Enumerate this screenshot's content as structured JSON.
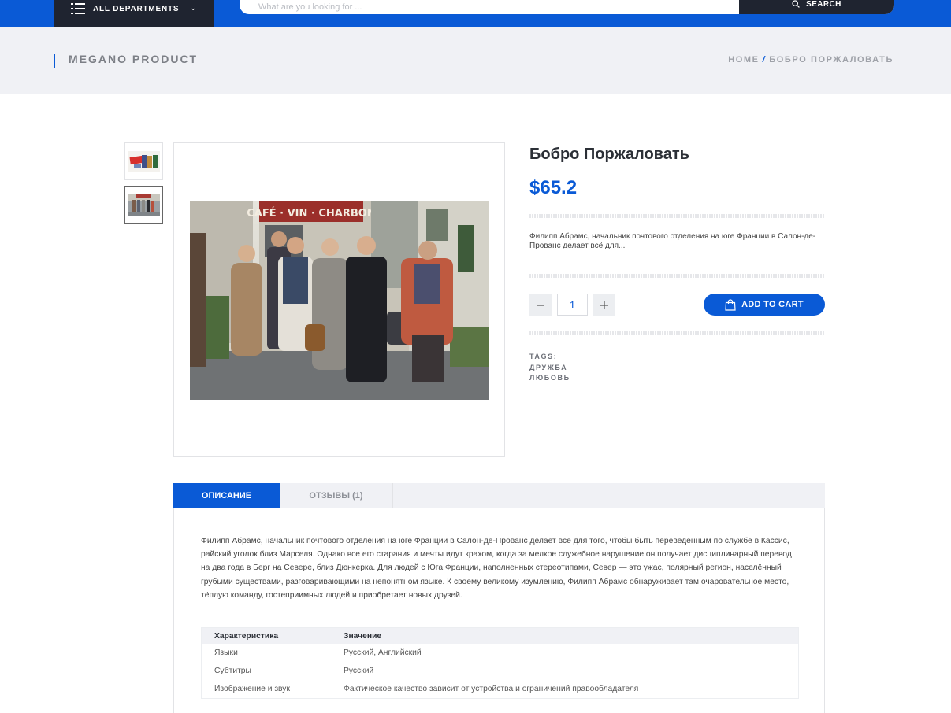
{
  "header": {
    "departments_label": "ALL DEPARTMENTS",
    "search_placeholder": "What are you looking for ...",
    "search_button": "SEARCH"
  },
  "titlebar": {
    "title": "MEGANO PRODUCT",
    "breadcrumb": {
      "home": "HOME",
      "separator": "/",
      "current": "БОБРО ПОРЖАЛОВАТЬ"
    }
  },
  "product": {
    "title": "Бобро Поржаловать",
    "price": "$65.2",
    "short_description": "Филипп Абрамс, начальник почтового отделения на юге Франции в Салон-де-Прованс делает всё для...",
    "quantity": "1",
    "add_to_cart": "ADD TO CART",
    "tags_label": "TAGS:",
    "tags": [
      "ДРУЖБА",
      "ЛЮБОВЬ"
    ],
    "photo_sign_text": "CAFÉ · VIN · CHARBON"
  },
  "tabs": {
    "description": "ОПИСАНИЕ",
    "reviews": "ОТЗЫВЫ (1)"
  },
  "description": {
    "text": "Филипп Абрамс, начальник почтового отделения на юге Франции в Салон-де-Прованс делает всё для того, чтобы быть переведённым по службе в Кассис, райский уголок близ Марселя. Однако все его старания и мечты идут крахом, когда за мелкое служебное нарушение он получает дисциплинарный перевод на два года в Берг на Севере, близ Дюнкерка. Для людей с Юга Франции, наполненных стереотипами, Север — это ужас, полярный регион, населённый грубыми существами, разговаривающими на непонятном языке. К своему великому изумлению, Филипп Абрамс обнаруживает там очаровательное место, тёплую команду, гостеприимных людей и приобретает новых друзей."
  },
  "specs": {
    "headers": [
      "Характеристика",
      "Значение"
    ],
    "rows": [
      [
        "Языки",
        "Русский, Английский"
      ],
      [
        "Субтитры",
        "Русский"
      ],
      [
        "Изображение и звук",
        "Фактическое качество зависит от устройства и ограничений правообладателя"
      ]
    ]
  },
  "colors": {
    "accent": "#0a5ad6",
    "dark": "#1f2430",
    "light_bg": "#f0f1f5"
  }
}
